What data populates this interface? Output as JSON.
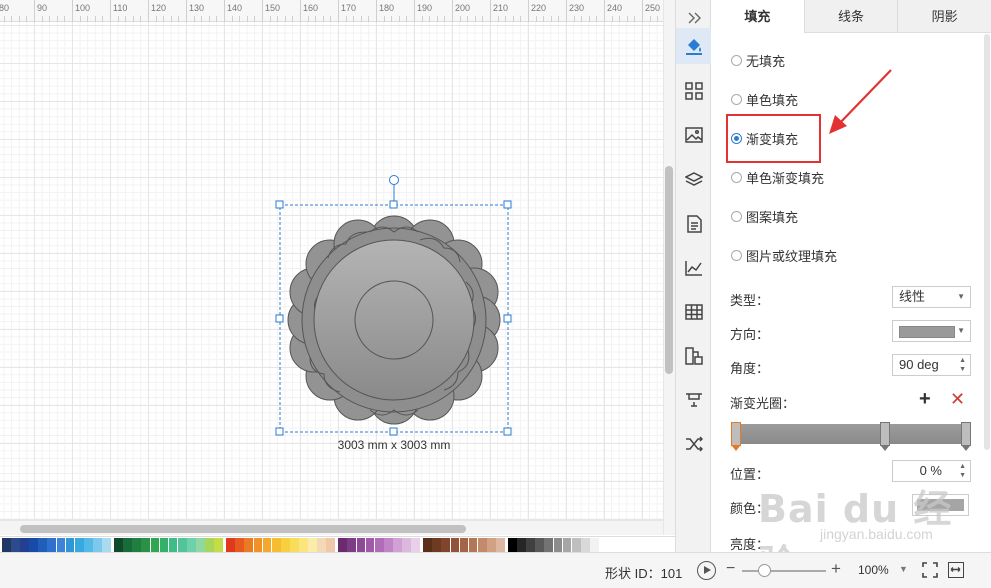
{
  "ruler": {
    "labels": [
      "80",
      "90",
      "100",
      "110",
      "120",
      "130",
      "140",
      "150",
      "160",
      "170",
      "180",
      "190",
      "200",
      "210",
      "220",
      "230",
      "240",
      "250"
    ]
  },
  "canvas": {
    "dimension_label": "3003 mm x 3003 mm"
  },
  "palette": [
    "#1f3864",
    "#2e4a8a",
    "#233f91",
    "#1a4aa8",
    "#1f5fb8",
    "#2f6fd0",
    "#3f83d8",
    "#2f97d6",
    "#36a9e1",
    "#53b9e6",
    "#7ec8eb",
    "#a8dbf0",
    "#0f4a2a",
    "#1a6b3a",
    "#1f7f40",
    "#2a9145",
    "#2fa650",
    "#35b06a",
    "#3fbd86",
    "#53c49a",
    "#6fd0ae",
    "#8fd8a2",
    "#a8d65a",
    "#c4dc46",
    "#e03a1e",
    "#e65a1f",
    "#ec7a22",
    "#f09228",
    "#f3a92c",
    "#f6bd33",
    "#f8cf3c",
    "#f9dc5a",
    "#fbe57f",
    "#fcecaa",
    "#f4d9b6",
    "#f0c8a6",
    "#6b2b6e",
    "#7c3c86",
    "#8e4a98",
    "#a05aa8",
    "#b06cb6",
    "#c184c6",
    "#d1a0d4",
    "#dcb8de",
    "#e8d0ea",
    "#5c2e1a",
    "#6e3a22",
    "#80462b",
    "#925437",
    "#a46445",
    "#b47756",
    "#c38b6b",
    "#d1a184",
    "#ddb79f",
    "#000000",
    "#262626",
    "#404040",
    "#595959",
    "#737373",
    "#8c8c8c",
    "#a6a6a6",
    "#bfbfbf",
    "#d9d9d9",
    "#f2f2f2"
  ],
  "status": {
    "shape_id": "形状 ID：101",
    "zoom": "100%"
  },
  "tabs": [
    "填充",
    "线条",
    "阴影"
  ],
  "fill_options": [
    {
      "label": "无填充",
      "selected": false
    },
    {
      "label": "单色填充",
      "selected": false
    },
    {
      "label": "渐变填充",
      "selected": true
    },
    {
      "label": "单色渐变填充",
      "selected": false
    },
    {
      "label": "图案填充",
      "selected": false
    },
    {
      "label": "图片或纹理填充",
      "selected": false
    }
  ],
  "fields": {
    "type_label": "类型：",
    "type_value": "线性",
    "direction_label": "方向：",
    "angle_label": "角度：",
    "angle_value": "90 deg",
    "stops_label": "渐变光圈：",
    "position_label": "位置：",
    "position_value": "0 %",
    "color_label": "颜色：",
    "brightness_label": "亮度："
  },
  "colors": {
    "accent": "#2a7bd4",
    "highlight": "#e23232",
    "shape_fill": "#9a9a9a",
    "selected_stop": "#e8791e"
  },
  "watermark": {
    "main": "Bai du 经验",
    "sub": "jingyan.baidu.com"
  },
  "icons": [
    "collapse-icon",
    "paint-bucket-icon",
    "grid-icon",
    "image-icon",
    "layers-icon",
    "page-icon",
    "chart-icon",
    "table-icon",
    "org-chart-icon",
    "presentation-icon",
    "shuffle-icon"
  ]
}
